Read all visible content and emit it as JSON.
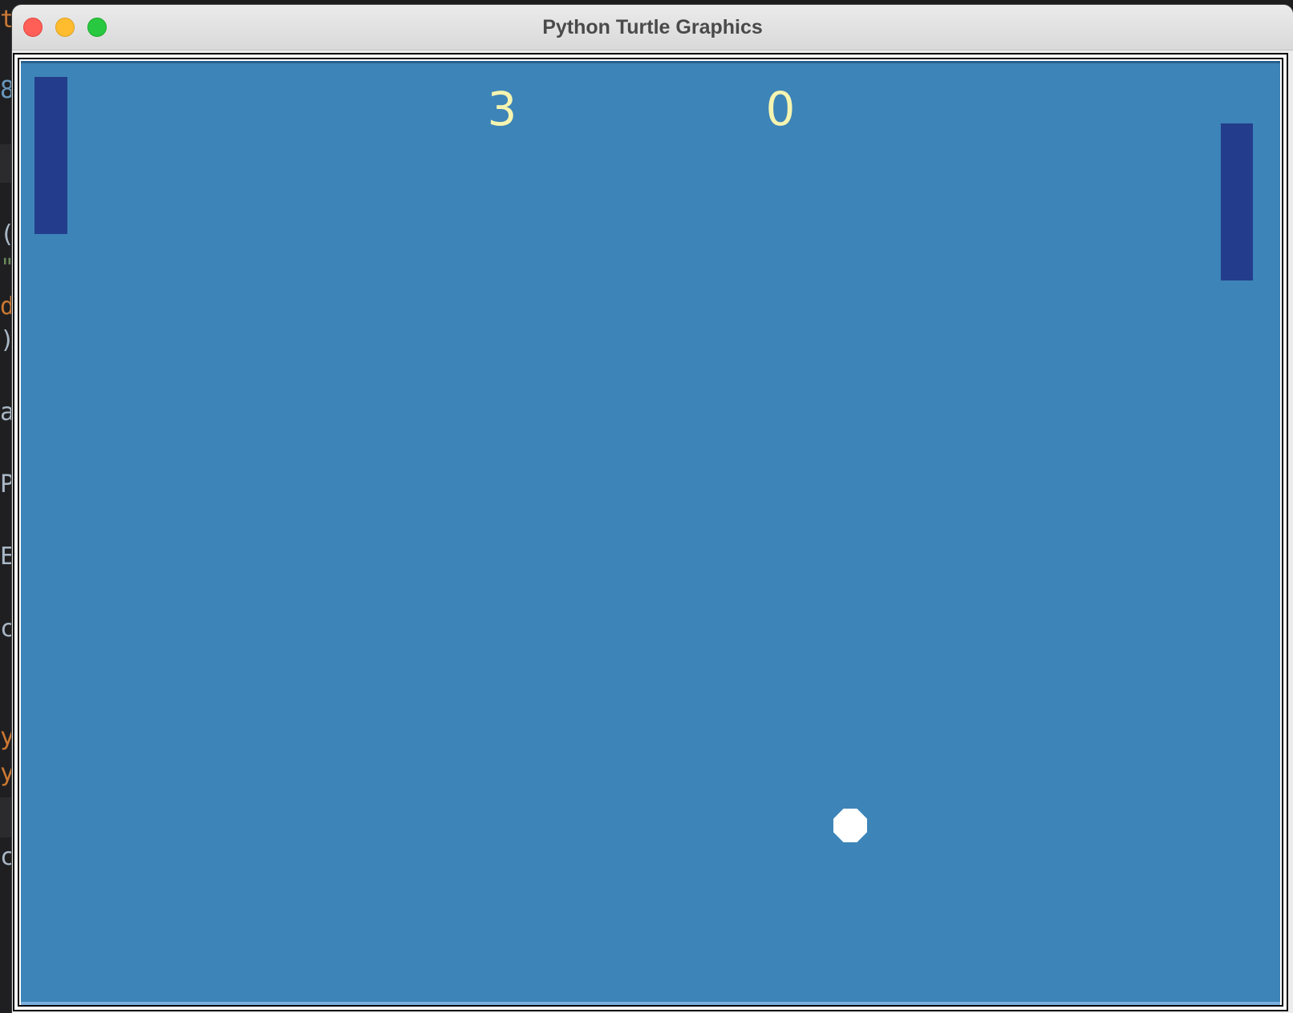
{
  "window": {
    "title": "Python Turtle Graphics"
  },
  "background_editor": {
    "glyphs": [
      "t",
      "8",
      "(",
      "\"",
      "d",
      ")",
      "a",
      "P",
      "E",
      "c",
      "y",
      "y",
      "c"
    ]
  },
  "game": {
    "score_left": "3",
    "score_right": "0"
  },
  "colors": {
    "canvas_background": "#3d84b8",
    "paddle": "#233d8c",
    "score_text": "#f5f4b0",
    "ball": "#ffffff"
  }
}
